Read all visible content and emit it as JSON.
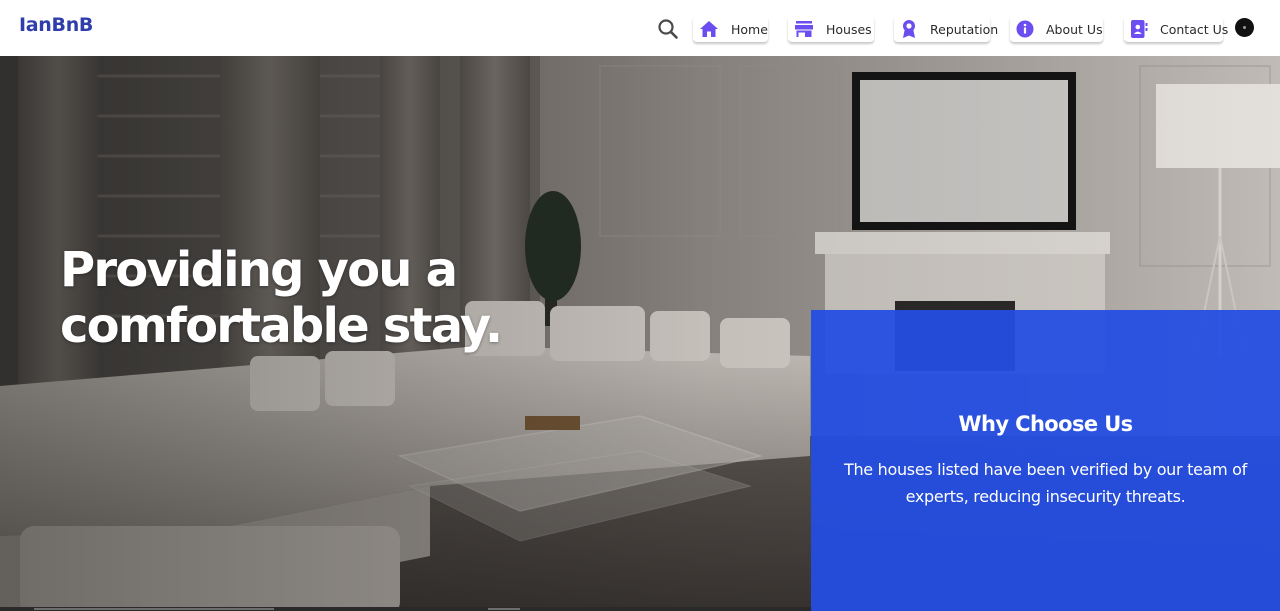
{
  "brand": {
    "name": "IanBnB"
  },
  "nav": {
    "search_icon": "search-icon",
    "items": [
      {
        "label": "Home",
        "icon": "home-icon",
        "icon_color": "#6c4df0"
      },
      {
        "label": "Houses",
        "icon": "store-icon",
        "icon_color": "#6c4df0"
      },
      {
        "label": "Reputation",
        "icon": "award-icon",
        "icon_color": "#6c4df0"
      },
      {
        "label": "About Us",
        "icon": "info-icon",
        "icon_color": "#6c4df0"
      },
      {
        "label": "Contact Us",
        "icon": "contact-card-icon",
        "icon_color": "#6c4df0"
      }
    ],
    "profile_icon": "avatar-icon"
  },
  "hero": {
    "title_line1": "Providing you a",
    "title_line2": "comfortable stay.",
    "why": {
      "title": "Why Choose Us",
      "text": "The houses listed have been verified by our team of experts, reducing insecurity threats."
    }
  },
  "colors": {
    "brand": "#2f3eaa",
    "accent_icon": "#6c4df0",
    "panel": "#234ee2"
  }
}
